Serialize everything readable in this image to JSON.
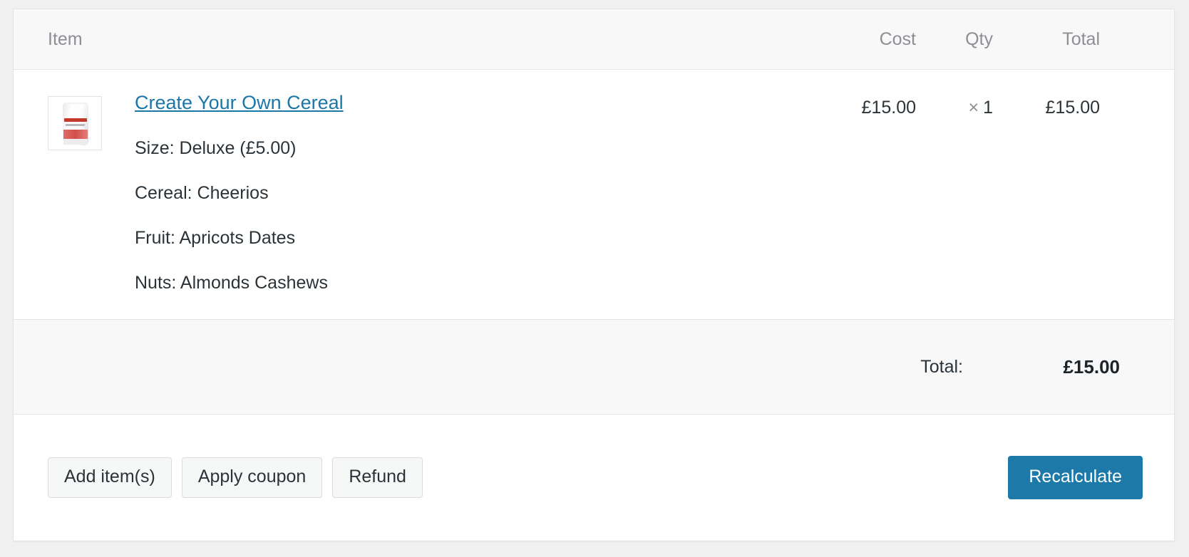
{
  "panel": {
    "columns": {
      "item": "Item",
      "cost": "Cost",
      "qty": "Qty",
      "total": "Total"
    },
    "line_items": [
      {
        "thumbnail_alt": "product-thumbnail",
        "name": "Create Your Own Cereal",
        "meta": [
          "Size: Deluxe (£5.00)",
          "Cereal: Cheerios",
          "Fruit: Apricots Dates",
          "Nuts: Almonds Cashews"
        ],
        "cost": "£15.00",
        "qty_symbol": "×",
        "qty": "1",
        "line_total": "£15.00"
      }
    ],
    "totals": {
      "label": "Total:",
      "value": "£15.00"
    },
    "footer": {
      "add_items": "Add item(s)",
      "apply_coupon": "Apply coupon",
      "refund": "Refund",
      "recalculate": "Recalculate"
    }
  },
  "colors": {
    "link": "#1d76a8",
    "primary_button": "#1d7aa8",
    "panel_background": "#ffffff",
    "header_background": "#f8f8f8",
    "page_background": "#f0f0f1",
    "border": "#e5e5e5",
    "muted_text": "#8c8f94",
    "body_text": "#2c3338"
  }
}
